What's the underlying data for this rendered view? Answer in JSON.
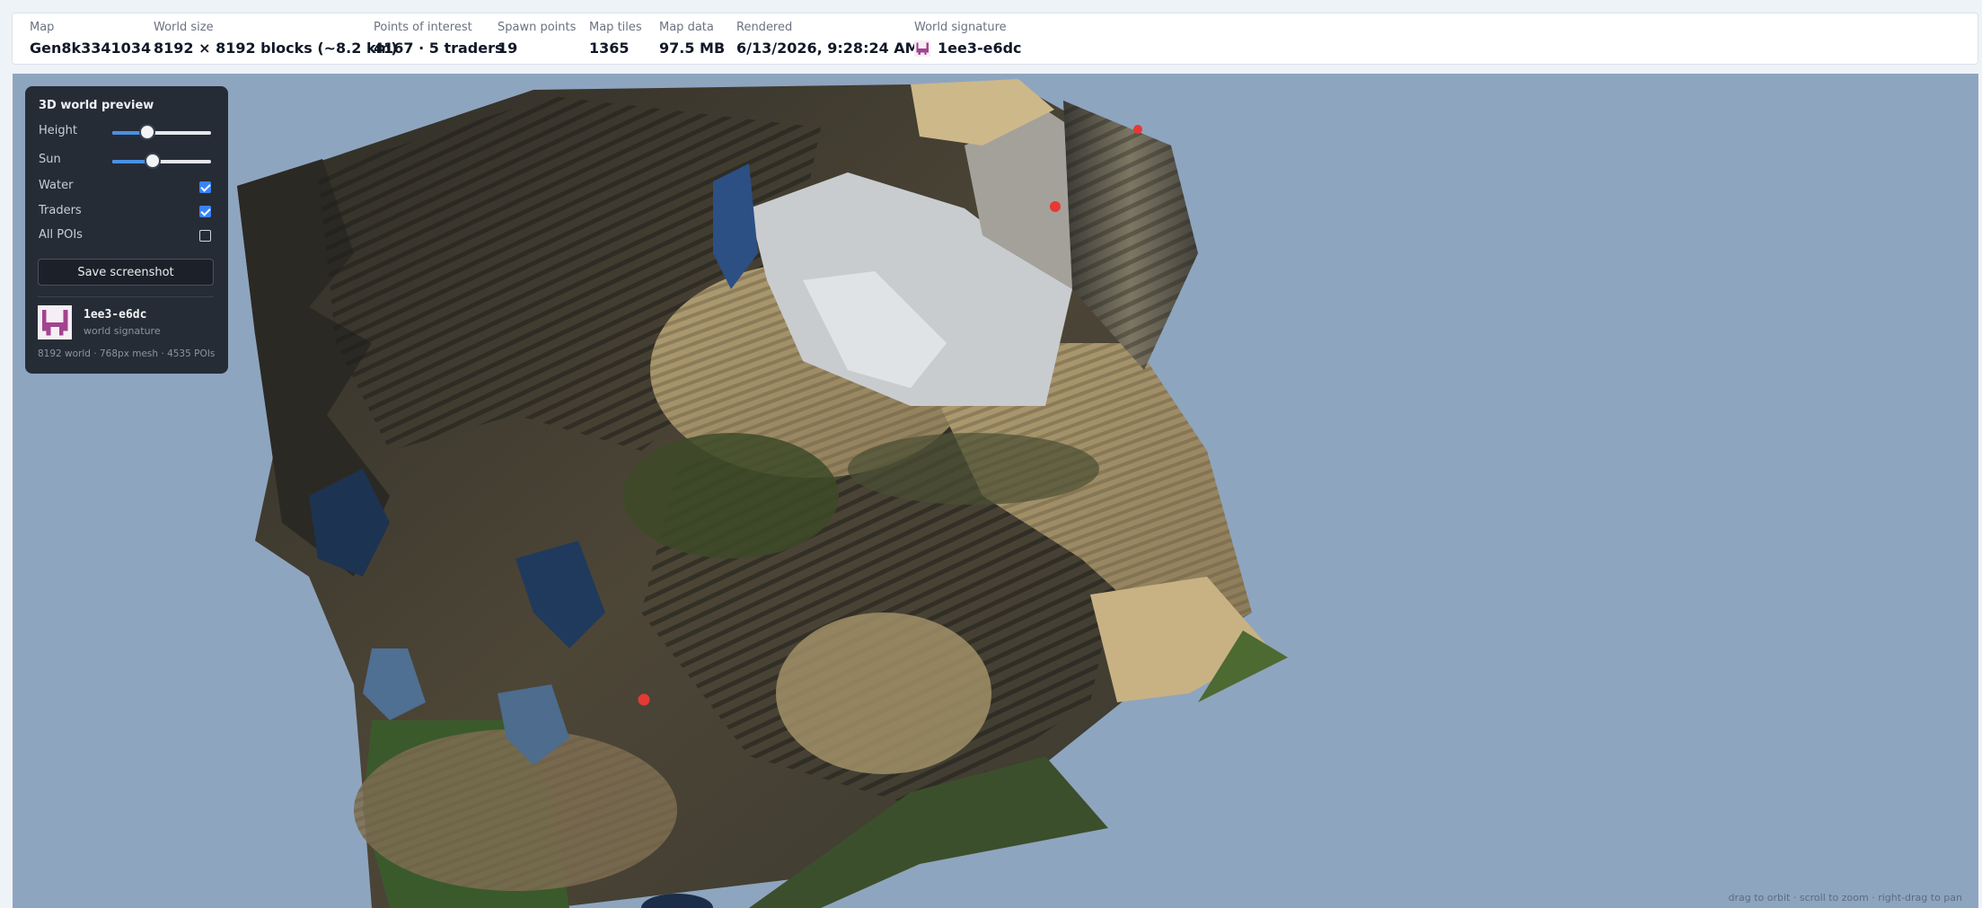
{
  "stats": [
    {
      "label": "Map",
      "value": "Gen8k3341034"
    },
    {
      "label": "World size",
      "value": "8192 × 8192 blocks (~8.2 km)"
    },
    {
      "label": "Points of interest",
      "value": "4167 · 5 traders"
    },
    {
      "label": "Spawn points",
      "value": "19"
    },
    {
      "label": "Map tiles",
      "value": "1365"
    },
    {
      "label": "Map data",
      "value": "97.5 MB"
    },
    {
      "label": "Rendered",
      "value": "6/13/2026, 9:28:24 AM"
    }
  ],
  "signature": {
    "label": "World signature",
    "value": "1ee3-e6dc",
    "icon": "signature-avatar-icon"
  },
  "panel": {
    "title": "3D world preview",
    "height": {
      "label": "Height",
      "value": 0.35
    },
    "sun": {
      "label": "Sun",
      "value": 0.41
    },
    "water": {
      "label": "Water",
      "checked": true
    },
    "traders": {
      "label": "Traders",
      "checked": true
    },
    "all_pois": {
      "label": "All POIs",
      "checked": false
    },
    "save_label": "Save screenshot",
    "signature_hash": "1ee3-e6dc",
    "signature_caption": "world signature",
    "footer": "8192 world · 768px mesh · 4535 POIs"
  },
  "viewport": {
    "hint": "drag to orbit · scroll to zoom · right-drag to pan",
    "background": "#8ea5bf"
  },
  "colors": {
    "accent": "#3b82f6",
    "avatar": "#a2448f",
    "marker": "#e53935"
  }
}
